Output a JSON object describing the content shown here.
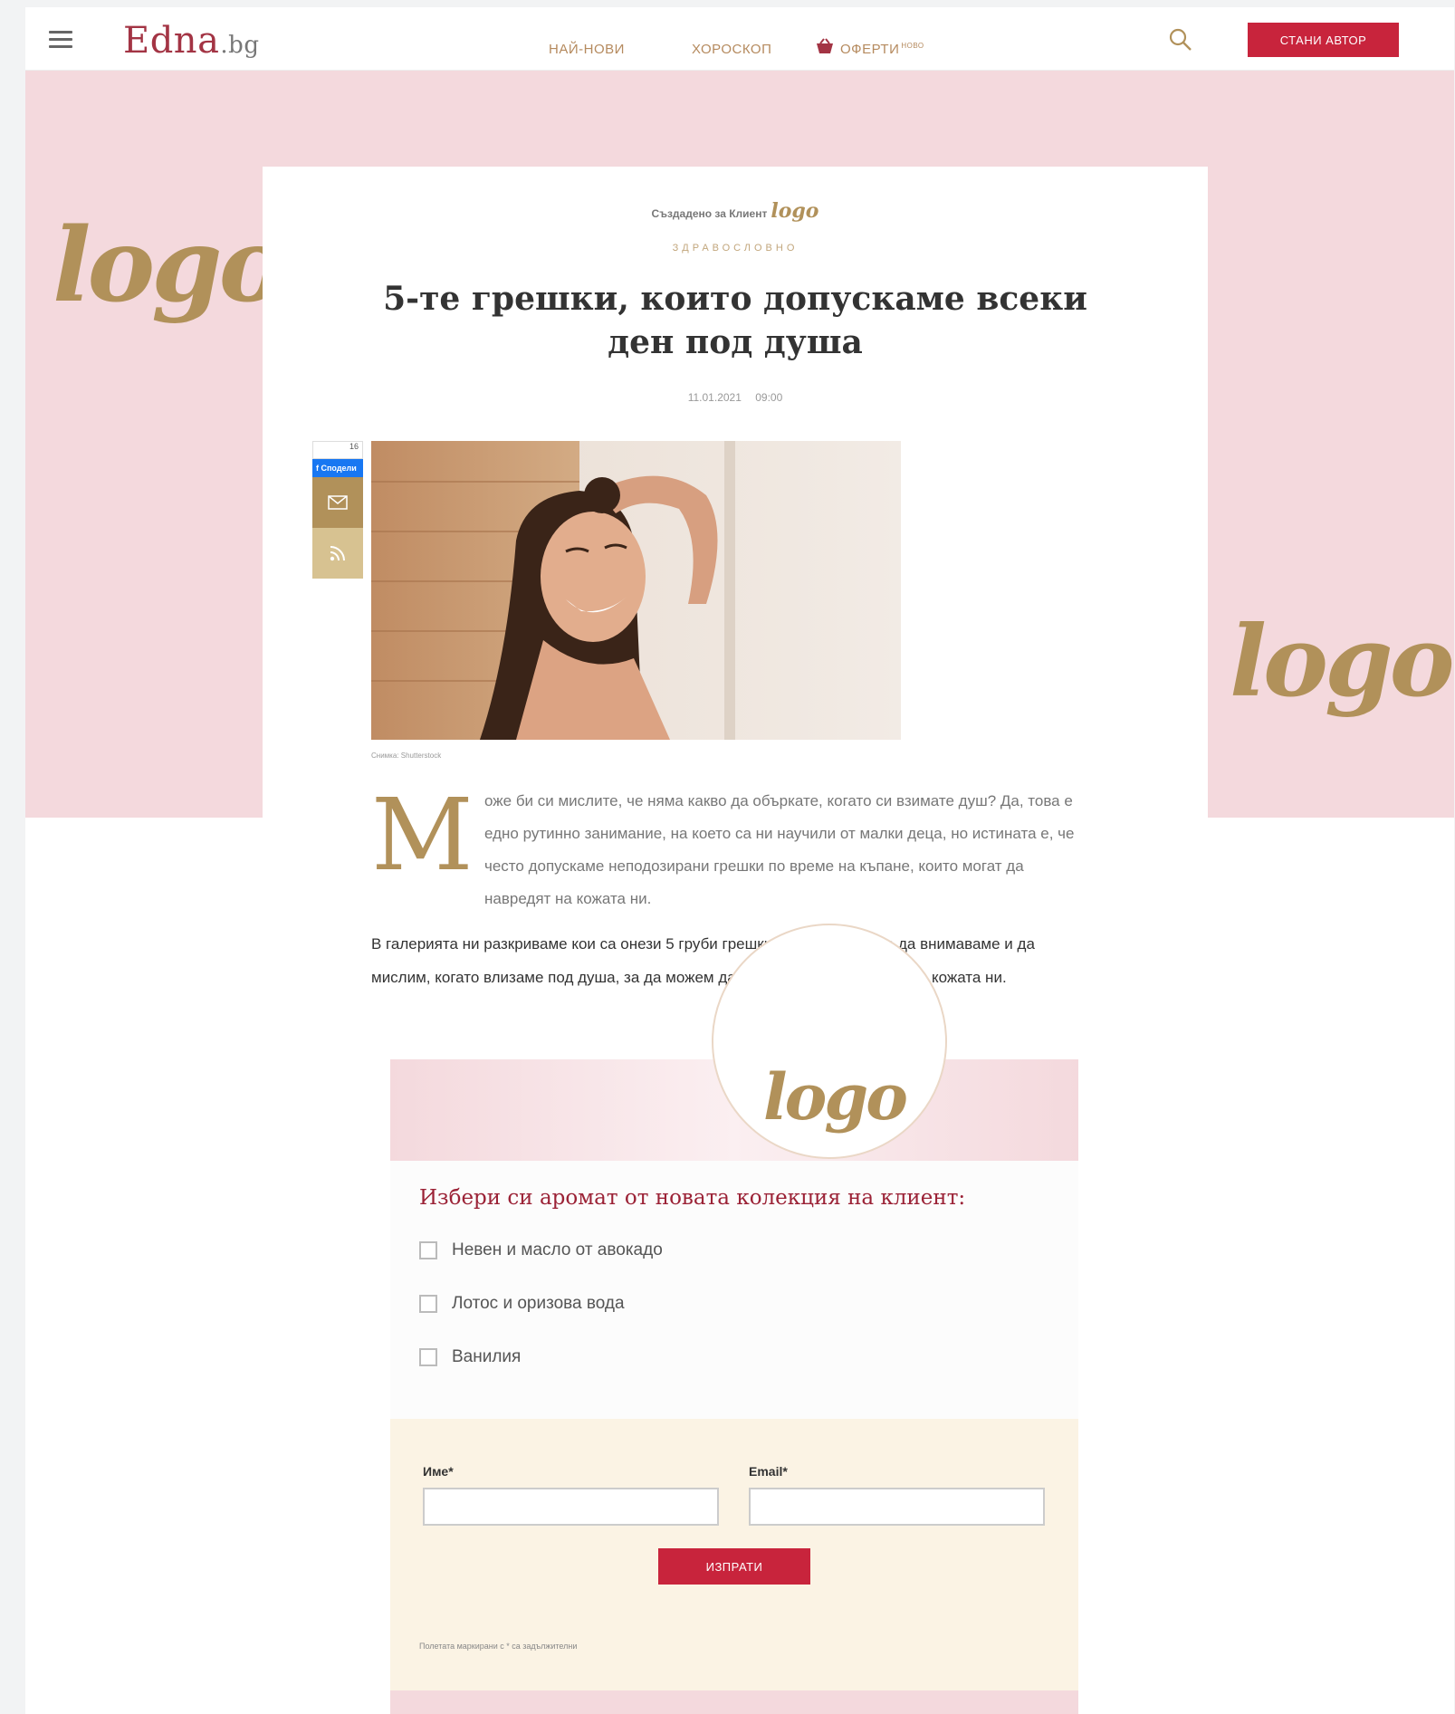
{
  "header": {
    "site_name": "Edna",
    "site_tld": ".bg",
    "nav": [
      "НАЙ-НОВИ",
      "ХОРОСКОП",
      "ОФЕРТИ"
    ],
    "nav_badge": "НОВО",
    "cta_label": "СТАНИ АВТОР"
  },
  "brand": {
    "logo_text": "logo",
    "accent_color": "#b1915a",
    "band_color": "#f4d9dd",
    "cta_color": "#c8243c"
  },
  "article": {
    "sponsor_label": "Създадено за Клиент",
    "category": "ЗДРАВОСЛОВНО",
    "title": "5-те грешки, които допускаме всеки ден под душа",
    "date": "11.01.2021",
    "time": "09:00",
    "share_count": "16",
    "share_label": "Сподели",
    "image_caption": "Снимка: Shutterstock",
    "dropcap": "М",
    "intro": "оже би си мислите, че няма какво да объркате, когато си взимате душ? Да, това е едно рутинно занимание, на което са ни научили от малки деца, но истината е, че често допускаме неподозирани грешки по време на къпане, които могат да навредят на кожата ни.",
    "body": "В галерията ни разкриваме кои са онези 5 груби грешки, за които трябва да внимаваме и да мислим, когато влизаме под душа, за да можем да се грижим по-правилно за кожата ни."
  },
  "form": {
    "question": "Избери си аромат от новата колекция на клиент:",
    "options": [
      "Невен и масло от авокадо",
      "Лотос и оризова вода",
      "Ванилия"
    ],
    "name_label": "Име*",
    "email_label": "Email*",
    "name_value": "",
    "email_value": "",
    "submit_label": "ИЗПРАТИ",
    "required_note": "Полетата маркирани с * са задължителни"
  }
}
